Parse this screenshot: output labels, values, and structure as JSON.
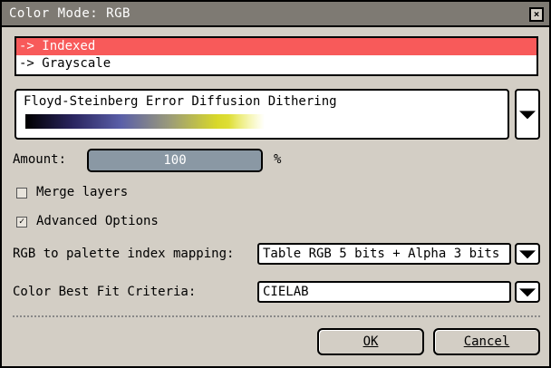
{
  "window": {
    "title": "Color Mode: RGB",
    "close_label": "×"
  },
  "mode_list": [
    {
      "label": "-> Indexed",
      "selected": true
    },
    {
      "label": "-> Grayscale",
      "selected": false
    }
  ],
  "dithering": {
    "label": "Floyd-Steinberg Error Diffusion Dithering"
  },
  "amount": {
    "label": "Amount:",
    "value": "100",
    "unit": "%",
    "fraction": 1.0
  },
  "merge_layers": {
    "label": "Merge layers",
    "checked": false
  },
  "advanced_options": {
    "label": "Advanced Options",
    "checked": true
  },
  "mapping": {
    "label": "RGB to palette index mapping:",
    "value": "Table RGB 5 bits + Alpha 3 bits"
  },
  "best_fit": {
    "label": "Color Best Fit Criteria:",
    "value": "CIELAB"
  },
  "buttons": {
    "ok": "OK",
    "cancel": "Cancel"
  },
  "colors": {
    "selected": "#f85a5a",
    "titlebar": "#7e7a73",
    "dialog_bg": "#d3cec5",
    "slider": "#8a98a4"
  }
}
